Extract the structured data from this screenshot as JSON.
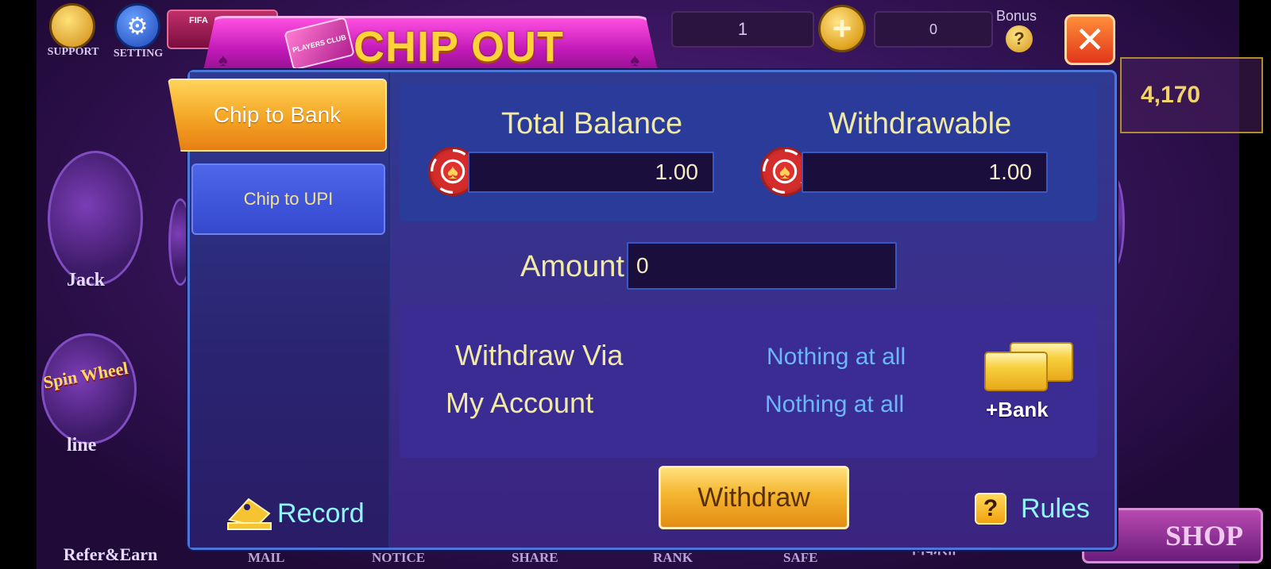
{
  "background": {
    "top_left": {
      "support_label": "SUPPORT",
      "setting_label": "SETTING",
      "fifa_label": "FIFA"
    },
    "top_bar": {
      "chip_count": "1",
      "bonus_value": "0",
      "bonus_label": "Bonus",
      "plus_icon": "plus-icon"
    },
    "side_balance": "4,170",
    "side_games": [
      {
        "label": "Jack"
      },
      {
        "label": "line"
      }
    ],
    "refer_label": "Refer&Earn",
    "bottom_nav": [
      {
        "label": "MAIL"
      },
      {
        "label": "NOTICE"
      },
      {
        "label": "SHARE"
      },
      {
        "label": "RANK"
      },
      {
        "label": "SAFE"
      },
      {
        "label": "निकासी"
      }
    ],
    "shop_label": "SHOP",
    "spin_wheel_label": "Spin Wheel"
  },
  "modal": {
    "title": "CHIP OUT",
    "title_card_text": "PLAYERS CLUB",
    "tabs": [
      {
        "label": "Chip to Bank",
        "active": true
      },
      {
        "label": "Chip to UPI",
        "active": false
      }
    ],
    "balances": {
      "total_label": "Total Balance",
      "total_value": "1.00",
      "withdrawable_label": "Withdrawable",
      "withdrawable_value": "1.00"
    },
    "amount": {
      "label": "Amount",
      "value": "0"
    },
    "withdraw_via": {
      "label": "Withdraw Via",
      "value": "Nothing at all"
    },
    "my_account": {
      "label": "My Account",
      "value": "Nothing at all"
    },
    "bank_button_label": "+Bank",
    "withdraw_button_label": "Withdraw",
    "record_label": "Record",
    "rules_label": "Rules",
    "rules_icon_text": "?",
    "close_icon": "close-icon"
  },
  "colors": {
    "accent_gold": "#f4b42e",
    "accent_cyan": "#8ff6ff",
    "value_blue": "#6cb6ff",
    "label_cream": "#f1e9a6",
    "title_pink": "#c21ab8"
  }
}
